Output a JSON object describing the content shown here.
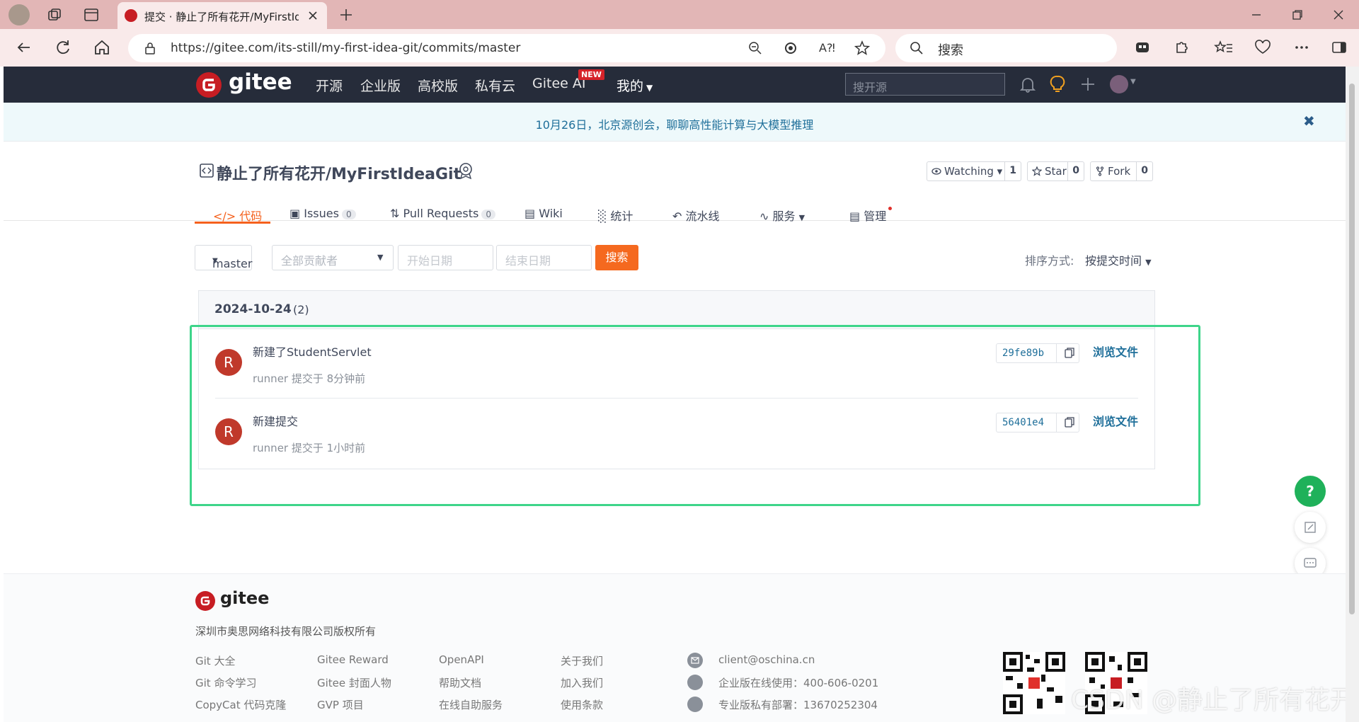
{
  "browser": {
    "tab_title": "提交 · 静止了所有花开/MyFirstIdeaGit",
    "url": "https://gitee.com/its-still/my-first-idea-git/commits/master",
    "search_placeholder": "搜索"
  },
  "header": {
    "logo": "gitee",
    "nav": [
      "开源",
      "企业版",
      "高校版",
      "私有云",
      "Gitee AI",
      "我的"
    ],
    "ai_badge": "NEW",
    "search_placeholder": "搜开源"
  },
  "notice": {
    "text": "10月26日，北京源创会，聊聊高性能计算与大模型推理",
    "close": "✖"
  },
  "project": {
    "title": "静止了所有花开/MyFirstIdeaGit",
    "watching_label": "Watching",
    "watching_count": "1",
    "star_label": "Star",
    "star_count": "0",
    "fork_label": "Fork",
    "fork_count": "0",
    "tabs": [
      {
        "label": "代码",
        "active": true
      },
      {
        "label": "Issues",
        "count": "0"
      },
      {
        "label": "Pull Requests",
        "count": "0"
      },
      {
        "label": "Wiki"
      },
      {
        "label": "统计"
      },
      {
        "label": "流水线"
      },
      {
        "label": "服务"
      },
      {
        "label": "管理"
      }
    ],
    "accent_color": "#f5611d"
  },
  "filters": {
    "branch": "master",
    "contributor_placeholder": "全部贡献者",
    "start_placeholder": "开始日期",
    "end_placeholder": "结束日期",
    "search_button": "搜索",
    "sort_label": "排序方式:",
    "sort_value": "按提交时间"
  },
  "commits": {
    "date": "2024-10-24",
    "count": "(2)",
    "items": [
      {
        "avatar": "R",
        "message": "新建了StudentServlet",
        "meta": "runner 提交于 8分钟前",
        "sha": "29fe89b",
        "browse": "浏览文件"
      },
      {
        "avatar": "R",
        "message": "新建提交",
        "meta": "runner 提交于 1小时前",
        "sha": "56401e4",
        "browse": "浏览文件"
      }
    ]
  },
  "footer": {
    "logo": "gitee",
    "copyright": "深圳市奥思网络科技有限公司版权所有",
    "col1": [
      "Git 大全",
      "Git 命令学习",
      "CopyCat 代码克隆"
    ],
    "col2": [
      "Gitee Reward",
      "Gitee 封面人物",
      "GVP 项目"
    ],
    "col3": [
      "OpenAPI",
      "帮助文档",
      "在线自助服务"
    ],
    "col4": [
      "关于我们",
      "加入我们",
      "使用条款"
    ],
    "contact": [
      "client@oschina.cn",
      "企业版在线使用：400-606-0201",
      "专业版私有部署：13670252304"
    ]
  },
  "watermark": "CSDN @静止了所有花开",
  "fab_help": "?"
}
